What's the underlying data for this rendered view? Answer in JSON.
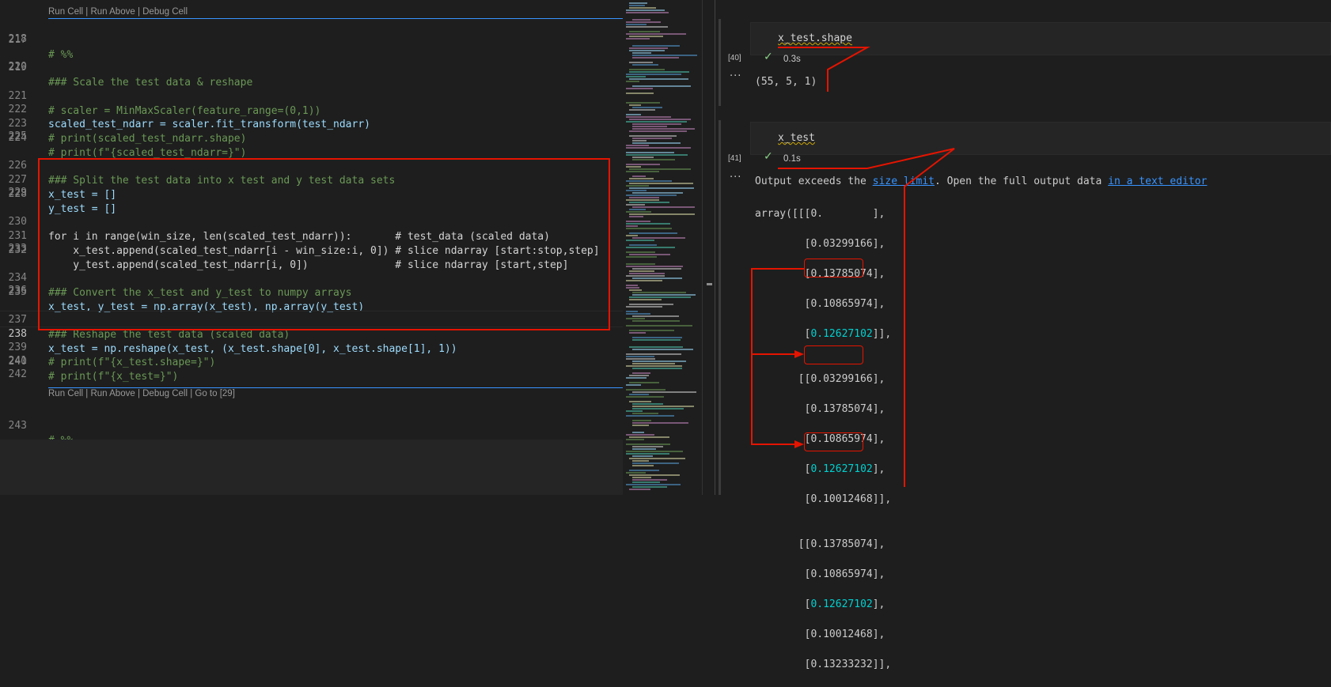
{
  "editor": {
    "codelens_top": "Run Cell | Run Above | Debug Cell",
    "codelens_bottom": "Run Cell | Run Above | Debug Cell | Go to [29]",
    "line_numbers": [
      "217",
      "219",
      "221",
      "222",
      "223",
      "224",
      "226",
      "227",
      "228",
      "230",
      "231",
      "232",
      "234",
      "235",
      "237",
      "238",
      "239",
      "240",
      "241",
      "242",
      "243"
    ],
    "lines": {
      "l217": "# %%",
      "l219": "### Scale the test data & reshape",
      "l221": "# scaler = MinMaxScaler(feature_range=(0,1))",
      "l222": "scaled_test_ndarr = scaler.fit_transform(test_ndarr)",
      "l223": "# print(scaled_test_ndarr.shape)",
      "l224": "# print(f\"{scaled_test_ndarr=}\")",
      "l226": "### Split the test data into x test and y test data sets",
      "l227": "x_test = []",
      "l228": "y_test = []",
      "l230": "for i in range(win_size, len(scaled_test_ndarr)):       # test_data (scaled data)",
      "l231": "    x_test.append(scaled_test_ndarr[i - win_size:i, 0]) # slice ndarray [start:stop,step]",
      "l232": "    y_test.append(scaled_test_ndarr[i, 0])              # slice ndarray [start,step]",
      "l234": "### Convert the x_test and y_test to numpy arrays",
      "l235": "x_test, y_test = np.array(x_test), np.array(y_test)",
      "l237": "### Reshape the test data (scaled data)",
      "l238": "x_test = np.reshape(x_test, (x_test.shape[0], x_test.shape[1], 1))",
      "l239": "# print(f\"{x_test.shape=}\")",
      "l240": "# print(f\"{x_test=}\")",
      "l243": "# %%"
    }
  },
  "notebook": {
    "cell1": {
      "source": "x_test.shape",
      "exec_count": "[40]",
      "time": "0.3s",
      "output": "(55, 5, 1)"
    },
    "cell2": {
      "source": "x_test",
      "exec_count": "[41]",
      "time": "0.1s",
      "msg_prefix": "Output exceeds the ",
      "msg_link1": "size limit",
      "msg_mid": ". Open the full output data ",
      "msg_link2": "in a text editor",
      "output_lines": [
        "array([[[0.        ],",
        "        [0.03299166],",
        "        [0.13785074],",
        "        [0.10865974],",
        "        [0.12627102]],",
        "",
        "       [[0.03299166],",
        "        [0.13785074],",
        "        [0.10865974],",
        "        [0.12627102],",
        "        [0.10012468]],",
        "",
        "       [[0.13785074],",
        "        [0.10865974],",
        "        [0.12627102],",
        "        [0.10012468],",
        "        [0.13233232]],"
      ],
      "highlight_value": "0.12627102"
    },
    "ellipsis": "···"
  },
  "icons": {
    "check": "check-icon",
    "more": "more-actions-icon"
  },
  "colors": {
    "annotation": "#e51400",
    "highlight": "#00d0d0",
    "accent": "#3794ff"
  }
}
